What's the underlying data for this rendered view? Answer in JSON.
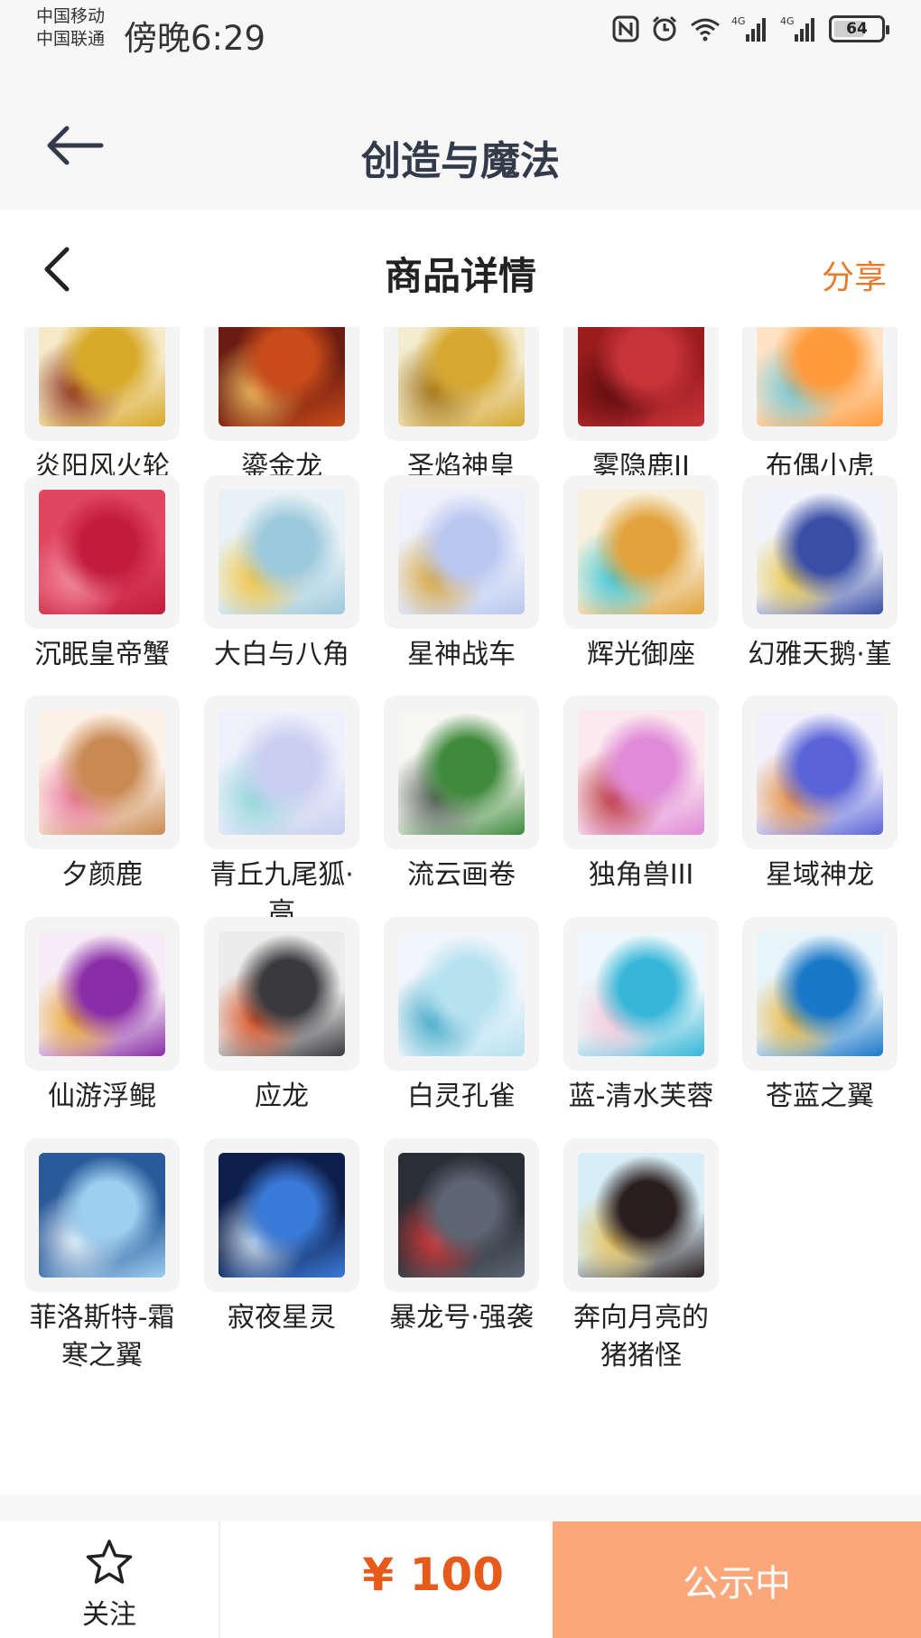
{
  "status_bar": {
    "carrier_1": "中国移动",
    "carrier_2": "中国联通",
    "time": "傍晚6:29",
    "battery": "64",
    "icons": [
      "nfc-icon",
      "alarm-icon",
      "wifi-icon",
      "signal-4g-icon",
      "signal-4g-icon",
      "battery-icon"
    ]
  },
  "app_header": {
    "title": "创造与魔法"
  },
  "detail": {
    "title": "商品详情",
    "share": "分享"
  },
  "items": [
    {
      "name": "炎阳风火轮",
      "colors": [
        "#f5e9c8",
        "#d8a928",
        "#8a2a14"
      ]
    },
    {
      "name": "鎏金龙",
      "colors": [
        "#6b1c12",
        "#c84b1a",
        "#f0c060"
      ]
    },
    {
      "name": "圣焰神皇",
      "colors": [
        "#f4ecd0",
        "#d6a830",
        "#9c6e10"
      ]
    },
    {
      "name": "雾隐鹿II",
      "colors": [
        "#9a1c1c",
        "#c8343a",
        "#5c0c10"
      ]
    },
    {
      "name": "布偶小虎",
      "colors": [
        "#ffe3c4",
        "#ff9b3c",
        "#6fc6d8"
      ]
    },
    {
      "name": "沉眠皇帝蟹",
      "colors": [
        "#e04660",
        "#c21c3c",
        "#f28ea0"
      ]
    },
    {
      "name": "大白与八角",
      "colors": [
        "#e8f2f6",
        "#9dc9dc",
        "#f3c23a"
      ]
    },
    {
      "name": "星神战车",
      "colors": [
        "#eef1fb",
        "#b9c7f0",
        "#d5a23a"
      ]
    },
    {
      "name": "辉光御座",
      "colors": [
        "#f8f0dc",
        "#e2a23c",
        "#39c6d8"
      ]
    },
    {
      "name": "幻雅天鹅·堇",
      "colors": [
        "#f1f4fb",
        "#3a4ea6",
        "#e8c445"
      ]
    },
    {
      "name": "夕颜鹿",
      "colors": [
        "#fdf2e8",
        "#c98a52",
        "#e8749a"
      ]
    },
    {
      "name": "青丘九尾狐·高",
      "colors": [
        "#eef0fb",
        "#c8cff0",
        "#8fd6d8"
      ]
    },
    {
      "name": "流云画卷",
      "colors": [
        "#f6f7f3",
        "#3f8a3c",
        "#555d58"
      ]
    },
    {
      "name": "独角兽III",
      "colors": [
        "#fbe9ef",
        "#e08ad8",
        "#b8303c"
      ]
    },
    {
      "name": "星域神龙",
      "colors": [
        "#f1f0fb",
        "#5a64d8",
        "#e58a3c"
      ]
    },
    {
      "name": "仙游浮鲲",
      "colors": [
        "#f7ecf5",
        "#8a2ea8",
        "#e6a32c"
      ]
    },
    {
      "name": "应龙",
      "colors": [
        "#ececec",
        "#3a3a3e",
        "#d84c1c"
      ]
    },
    {
      "name": "白灵孔雀",
      "colors": [
        "#f1f6fb",
        "#b6e2f0",
        "#3aa6c6"
      ]
    },
    {
      "name": "蓝-清水芙蓉",
      "colors": [
        "#eef8fb",
        "#36b6d8",
        "#f6c8d8"
      ]
    },
    {
      "name": "苍蓝之翼",
      "colors": [
        "#e8f4fb",
        "#1a78c8",
        "#e8b43c"
      ]
    },
    {
      "name": "菲洛斯特-霜寒之翼",
      "colors": [
        "#2a5a9a",
        "#9ccff0",
        "#eef6fb"
      ]
    },
    {
      "name": "寂夜星灵",
      "colors": [
        "#0e1e4a",
        "#3a7ad8",
        "#d0e4f6"
      ]
    },
    {
      "name": "暴龙号·强袭",
      "colors": [
        "#2a2e36",
        "#5c6674",
        "#d83a3a"
      ]
    },
    {
      "name": "奔向月亮的猪猪怪",
      "colors": [
        "#d8eef6",
        "#2a1e1e",
        "#e8c25a"
      ]
    }
  ],
  "bottom_bar": {
    "follow_label": "关注",
    "price": "¥ 100",
    "status_button": "公示中"
  }
}
